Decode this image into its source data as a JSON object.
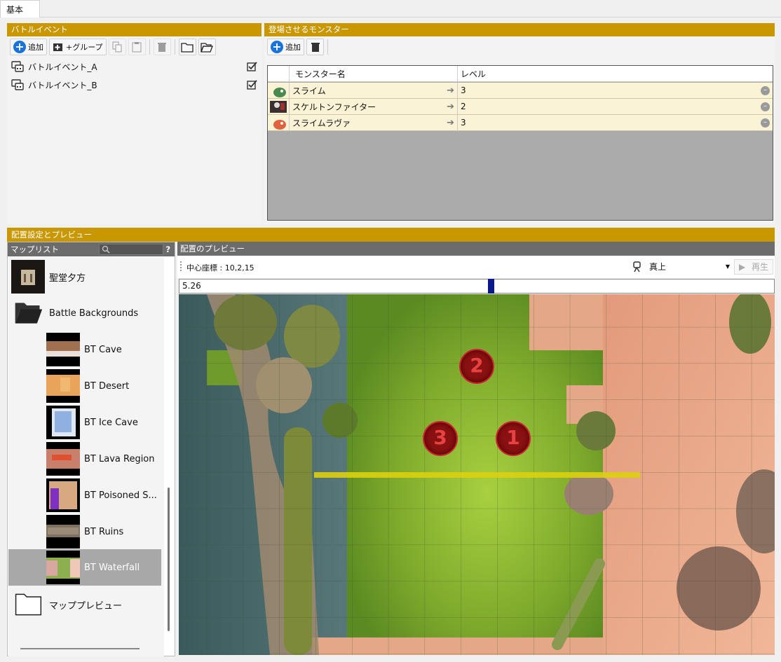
{
  "tabs": [
    "基本"
  ],
  "battle_events": {
    "header": "バトルイベント",
    "toolbar": {
      "add_label": "追加",
      "add_group_label": "+グループ"
    },
    "items": [
      {
        "label": "バトルイベント_A",
        "checked": true
      },
      {
        "label": "バトルイベント_B",
        "checked": true
      }
    ]
  },
  "monsters": {
    "header": "登場させるモンスター",
    "toolbar": {
      "add_label": "追加"
    },
    "columns": [
      "モンスター名",
      "レベル"
    ],
    "rows": [
      {
        "name": "スライム",
        "level": "3"
      },
      {
        "name": "スケルトンファイター",
        "level": "2"
      },
      {
        "name": "スライムラヴァ",
        "level": "3"
      }
    ]
  },
  "placement": {
    "header": "配置設定とプレビュー",
    "map_list": {
      "header": "マップリスト",
      "help": "?",
      "items": [
        {
          "label": "聖堂夕方",
          "type": "map",
          "thumb_color": "#2a2520"
        },
        {
          "label": "Battle Backgrounds",
          "type": "folder-open"
        },
        {
          "label": "BT Cave",
          "type": "map",
          "thumb_color": "#8a6040"
        },
        {
          "label": "BT Desert",
          "type": "map",
          "thumb_color": "#e0a055"
        },
        {
          "label": "BT Ice Cave",
          "type": "map",
          "thumb_color": "#a0c0e8"
        },
        {
          "label": "BT Lava Region",
          "type": "map",
          "thumb_color": "#c06040"
        },
        {
          "label": "BT Poisoned S...",
          "type": "map",
          "thumb_color": "#7040a0"
        },
        {
          "label": "BT Ruins",
          "type": "map",
          "thumb_color": "#807060"
        },
        {
          "label": "BT Waterfall",
          "type": "map",
          "thumb_color": "#7a9a40",
          "selected": true
        },
        {
          "label": "マッププレビュー",
          "type": "folder"
        }
      ]
    },
    "preview": {
      "header": "配置のプレビュー",
      "center_coords": "中心座標 : 10,2,15",
      "camera_select": "真上",
      "play_label": "再生",
      "timeline_value": "5.26",
      "markers": [
        "2",
        "3",
        "1"
      ]
    }
  }
}
